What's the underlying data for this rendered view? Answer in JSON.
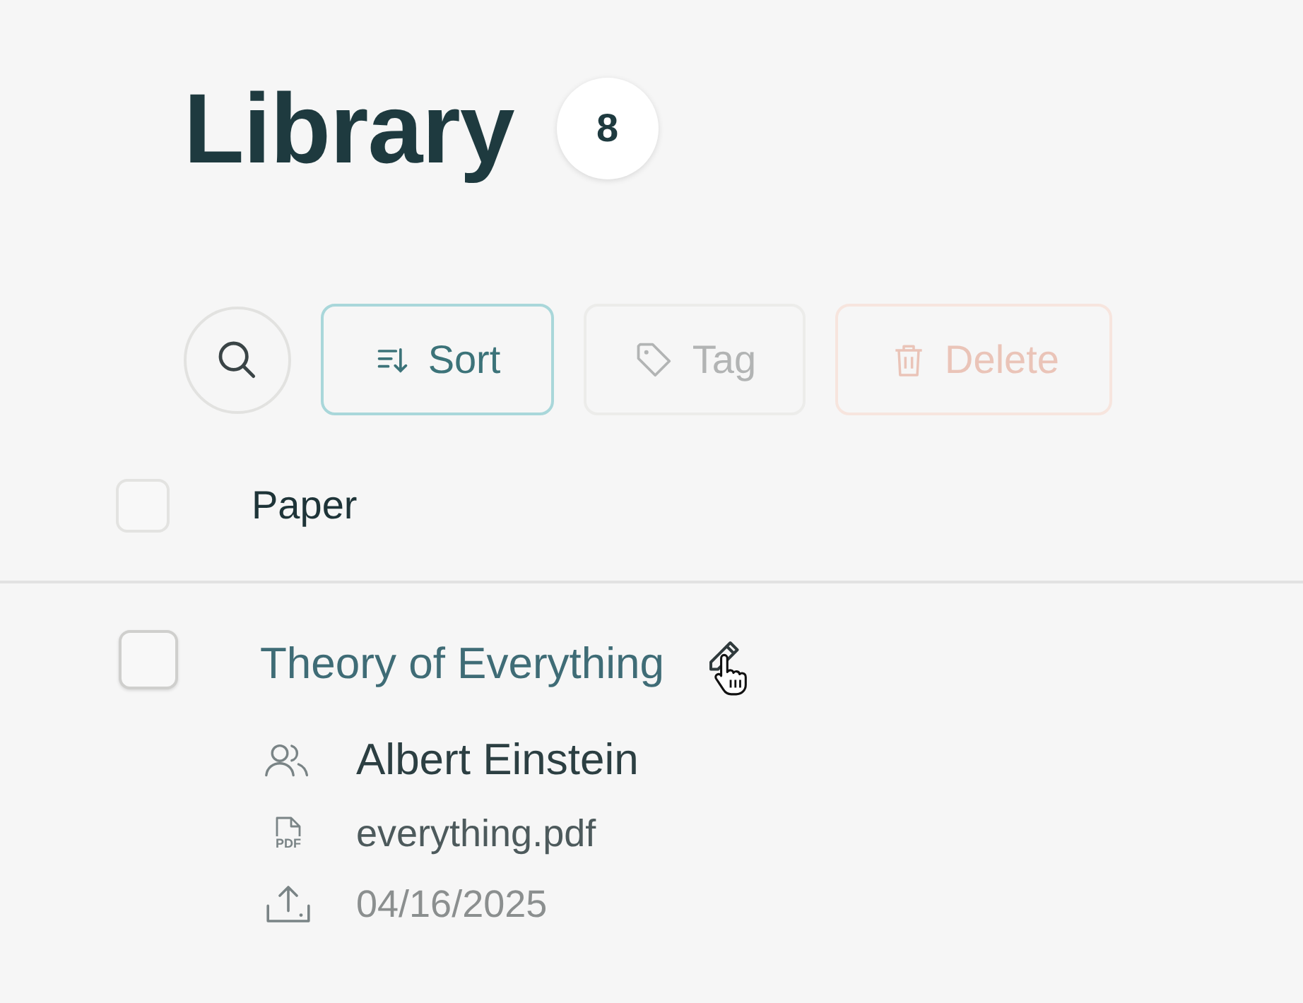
{
  "title": "Library",
  "count": "8",
  "toolbar": [
    {
      "kind": "search"
    },
    {
      "kind": "sort",
      "label": "Sort",
      "disabled": false
    },
    {
      "kind": "tag",
      "label": "Tag",
      "disabled": true
    },
    {
      "kind": "delete",
      "label": "Delete",
      "disabled": true
    }
  ],
  "table": {
    "header": {
      "checked": false,
      "column": "Paper"
    },
    "rows": [
      {
        "checked": false,
        "title": "Theory of Everything",
        "hovered_edit": true,
        "meta": [
          {
            "kind": "authors",
            "text": "Albert Einstein"
          },
          {
            "kind": "file",
            "icon_label": "PDF",
            "text": "everything.pdf"
          },
          {
            "kind": "uploaded",
            "text": "04/16/2025"
          }
        ]
      }
    ]
  }
}
